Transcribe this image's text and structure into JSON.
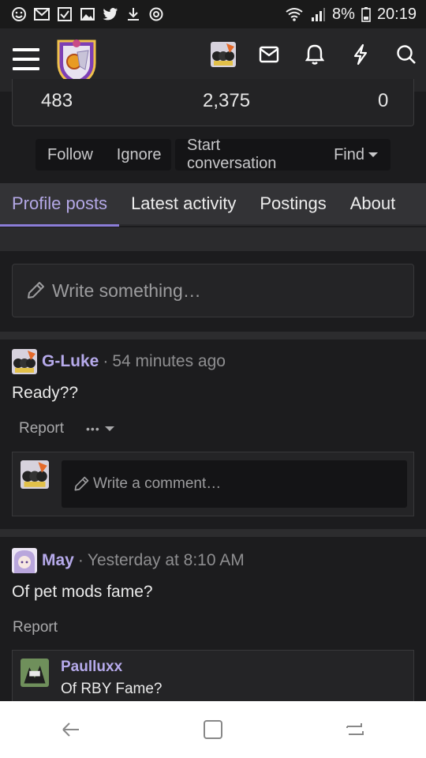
{
  "status_bar": {
    "battery": "8%",
    "time": "20:19",
    "icons": [
      "smiley-icon",
      "gmail-icon",
      "checkbox-icon",
      "gallery-icon",
      "twitter-icon",
      "download-icon",
      "sync-icon",
      "wifi-icon",
      "signal-icon",
      "battery-icon"
    ]
  },
  "nav": {
    "icons": [
      "avatar",
      "envelope-icon",
      "bell-icon",
      "bolt-icon",
      "search-icon"
    ]
  },
  "stats": {
    "values": [
      "483",
      "2,375",
      "0"
    ]
  },
  "actions": {
    "follow": "Follow",
    "ignore": "Ignore",
    "start_conversation": "Start conversation",
    "find": "Find"
  },
  "tabs": [
    {
      "label": "Profile posts",
      "active": true
    },
    {
      "label": "Latest activity",
      "active": false
    },
    {
      "label": "Postings",
      "active": false
    },
    {
      "label": "About",
      "active": false
    }
  ],
  "composer": {
    "placeholder": "Write something…"
  },
  "posts": [
    {
      "author": "G-Luke",
      "time": "54 minutes ago",
      "body": "Ready??",
      "report": "Report",
      "more": "•••",
      "comment_placeholder": "Write a comment…"
    },
    {
      "author": "May",
      "time": "Yesterday at 8:10 AM",
      "body": "Of pet mods fame?",
      "report": "Report",
      "reply": {
        "author": "Paulluxx",
        "body": "Of RBY Fame?"
      }
    }
  ],
  "colors": {
    "accent": "#8b7dd8",
    "username": "#b6aaeb",
    "background": "#1c1c1e"
  }
}
